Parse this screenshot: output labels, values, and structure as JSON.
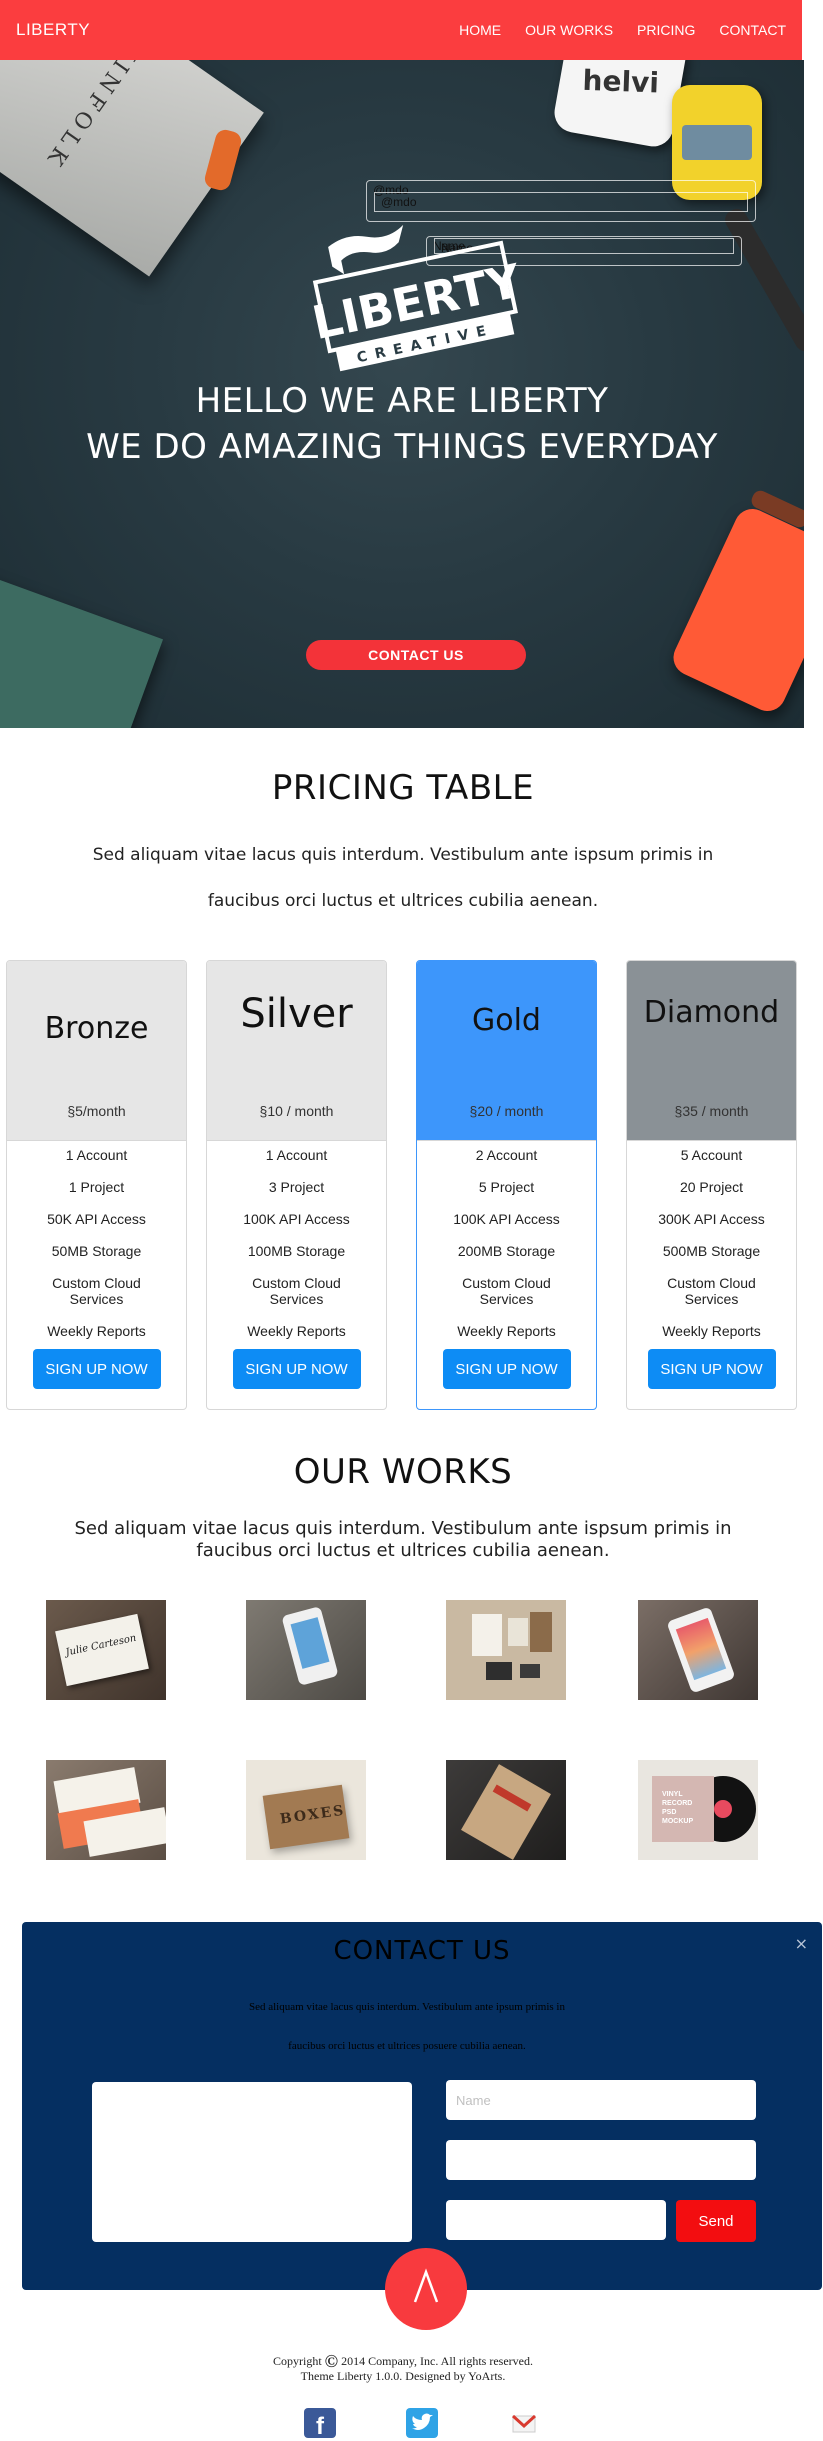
{
  "nav": {
    "brand": "LIBERTY",
    "links": [
      "HOME",
      "OUR WORKS",
      "PRICING",
      "CONTACT"
    ]
  },
  "hero": {
    "overlay_email_a": "@mdo",
    "overlay_email_b": "@mdo",
    "overlay_name_a": "Name",
    "overlay_name_b": "Name",
    "book_text": "KINFOLK",
    "jar_text": "helvi",
    "logo_main": "LIBERTY",
    "logo_sub": "CREATIVE",
    "heading_line1": "HELLO WE ARE LIBERTY",
    "heading_line2": "WE DO AMAZING THINGS EVERYDAY",
    "contact_button": "CONTACT US"
  },
  "pricing": {
    "title": "PRICING TABLE",
    "desc_line1": "Sed aliquam vitae lacus quis interdum. Vestibulum ante ispsum primis in",
    "desc_line2": "faucibus orci luctus et ultrices cubilia aenean.",
    "plans": [
      {
        "name": "Bronze",
        "price": "§5/month",
        "header_color": "#e6e6e6",
        "features": [
          "1 Account",
          "1 Project",
          "50K API Access",
          "50MB Storage",
          "Custom Cloud Services",
          "Weekly Reports"
        ],
        "button": "SIGN UP NOW"
      },
      {
        "name": "Silver",
        "price": "§10 / month",
        "header_color": "#e6e6e6",
        "features": [
          "1 Account",
          "3 Project",
          "100K API Access",
          "100MB Storage",
          "Custom Cloud Services",
          "Weekly Reports"
        ],
        "button": "SIGN UP NOW"
      },
      {
        "name": "Gold",
        "price": "§20 / month",
        "header_color": "#3d96fb",
        "features": [
          "2 Account",
          "5 Project",
          "100K API Access",
          "200MB Storage",
          "Custom Cloud Services",
          "Weekly Reports"
        ],
        "button": "SIGN UP NOW"
      },
      {
        "name": "Diamond",
        "price": "§35 / month",
        "header_color": "#8a9196",
        "features": [
          "5 Account",
          "20 Project",
          "300K API Access",
          "500MB Storage",
          "Custom Cloud Services",
          "Weekly Reports"
        ],
        "button": "SIGN UP NOW"
      }
    ]
  },
  "works": {
    "title": "OUR WORKS",
    "desc_line1": "Sed aliquam vitae lacus quis interdum. Vestibulum ante ispsum primis in",
    "desc_line2": "faucibus orci luctus et ultrices cubilia aenean.",
    "card_text_1": "Julie Carteson",
    "card_text_2": "BOXES",
    "card_text_3": "VINYL RECORD PSD MOCKUP"
  },
  "contact": {
    "title": "CONTACT  US",
    "close": "×",
    "desc_line1": "Sed aliquam vitae lacus quis interdum. Vestibulum ante ipsum primis in",
    "desc_line2": "faucibus orci luctus et ultrices posuere cubilia aenean.",
    "name_placeholder": "Name",
    "send": "Send"
  },
  "footer": {
    "copyright_line1": "Copyright",
    "copyright_line1_rest": " 2014 Company, Inc. All rights reserved.",
    "copyright_line2": "Theme Liberty 1.0.0. Designed by YoArts."
  },
  "colors": {
    "accent_red": "#fb3d3f",
    "contact_bg": "#052f61",
    "button_blue": "#0d8cf5",
    "send_red": "#f30d10"
  },
  "icons": [
    "copyright-icon",
    "arrow-up-icon",
    "facebook-icon",
    "twitter-icon",
    "gmail-icon",
    "close-icon"
  ]
}
